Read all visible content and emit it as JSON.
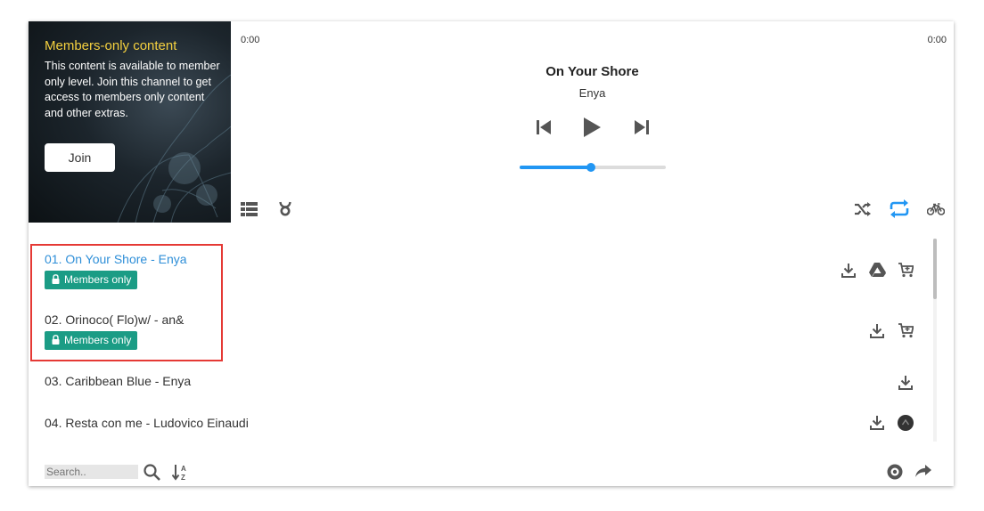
{
  "player": {
    "time_current": "0:00",
    "time_total": "0:00",
    "title": "On Your Shore",
    "artist": "Enya",
    "progress_fraction": 0.49
  },
  "members_card": {
    "heading": "Members-only content",
    "text": "This content is available to member only level. Join this channel to get access to members only content and other extras.",
    "join_label": "Join"
  },
  "tracks": [
    {
      "label": "01. On Your Shore - Enya",
      "badge": "Members only",
      "active": true
    },
    {
      "label": "02. Orinoco( Flo)w/ - an&",
      "badge": "Members only",
      "active": false
    },
    {
      "label": "03. Caribbean Blue - Enya"
    },
    {
      "label": "04. Resta con me - Ludovico Einaudi"
    }
  ],
  "search": {
    "placeholder": "Search.."
  },
  "colors": {
    "accent": "#2196f3",
    "badge": "#1b9c85",
    "highlight": "#e53935",
    "member_heading": "#f4d03f"
  }
}
